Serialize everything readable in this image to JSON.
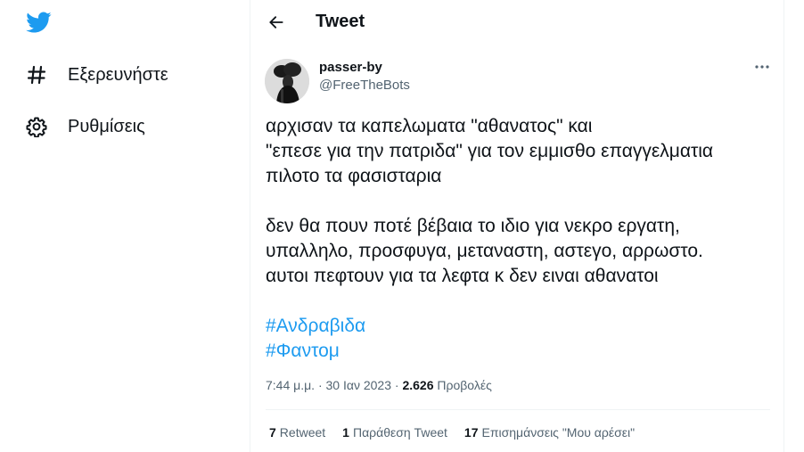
{
  "nav": {
    "logo_icon": "twitter-bird-icon",
    "items": [
      {
        "label": "Εξερευνήστε",
        "icon": "hashtag-icon"
      },
      {
        "label": "Ρυθμίσεις",
        "icon": "gear-icon"
      }
    ]
  },
  "header": {
    "title": "Tweet",
    "back_icon": "arrow-left-icon"
  },
  "tweet": {
    "author": {
      "name": "passer-by",
      "handle": "@FreeTheBots"
    },
    "text_lines_1": [
      "αρχισαν τα καπελωματα \"αθανατος\" και",
      "\"επεσε για την πατριδα\" για τον εμμισθο επαγγελματια",
      "πιλοτο τα φασισταρια"
    ],
    "text_lines_2": [
      "δεν θα πουν ποτέ βέβαια το ιδιο για νεκρο εργατη,",
      "υπαλληλο, προσφυγα, μεταναστη, αστεγο, αρρωστο.",
      "αυτοι πεφτουν για τα λεφτα κ δεν ειναι αθανατοι"
    ],
    "hashtags": [
      "#Ανδραβιδα",
      "#Φαντομ"
    ],
    "time": "7:44 μ.μ.",
    "date": "30 Ιαν 2023",
    "separator": "·",
    "views_count": "2.626",
    "views_label": "Προβολές",
    "stats": [
      {
        "count": "7",
        "label": "Retweet"
      },
      {
        "count": "1",
        "label": "Παράθεση Tweet"
      },
      {
        "count": "17",
        "label": "Επισημάνσεις \"Μου αρέσει\""
      }
    ]
  },
  "colors": {
    "accent": "#1d9bf0",
    "text": "#0f1419",
    "secondary": "#536471",
    "border": "#eff3f4"
  }
}
